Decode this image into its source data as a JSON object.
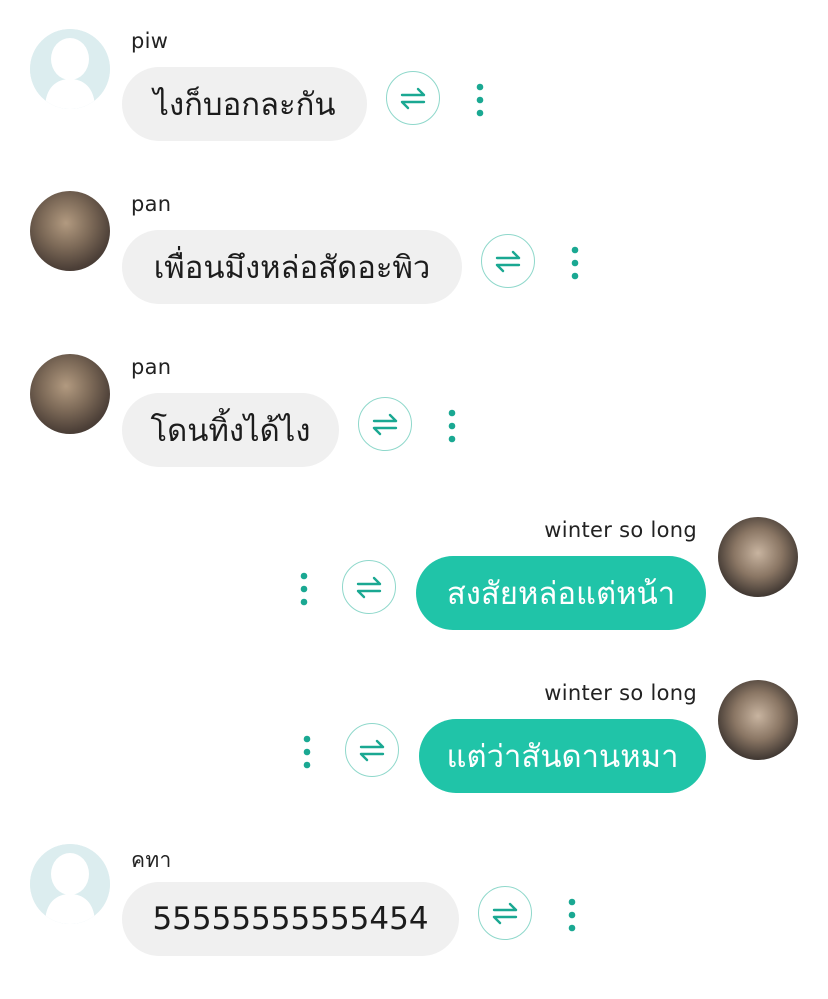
{
  "messages": [
    {
      "sender": "piw",
      "text": "ไงก็บอกละกัน",
      "direction": "incoming",
      "avatar": "default-avatar"
    },
    {
      "sender": "pan",
      "text": "เพื่อนมึงหล่อสัดอะพิว",
      "direction": "incoming",
      "avatar": "photo-avatar"
    },
    {
      "sender": "pan",
      "text": "โดนทิ้งได้ไง",
      "direction": "incoming",
      "avatar": "photo-avatar"
    },
    {
      "sender": "winter so long",
      "text": "สงสัยหล่อแต่หน้า",
      "direction": "outgoing",
      "avatar": "photo-avatar"
    },
    {
      "sender": "winter so long",
      "text": "แต่ว่าสันดานหมา",
      "direction": "outgoing",
      "avatar": "photo-avatar"
    },
    {
      "sender": "คทา",
      "text": "55555555555454",
      "direction": "incoming",
      "avatar": "default-avatar"
    }
  ],
  "icons": {
    "translate": "swap-arrows-icon",
    "more": "vertical-dots-icon",
    "default_avatar": "person-silhouette-icon"
  },
  "colors": {
    "accent": "#20c4a8",
    "incoming_bubble": "#f0f0f0",
    "avatar_placeholder": "#dcedef",
    "icon_teal": "#1aa892"
  }
}
